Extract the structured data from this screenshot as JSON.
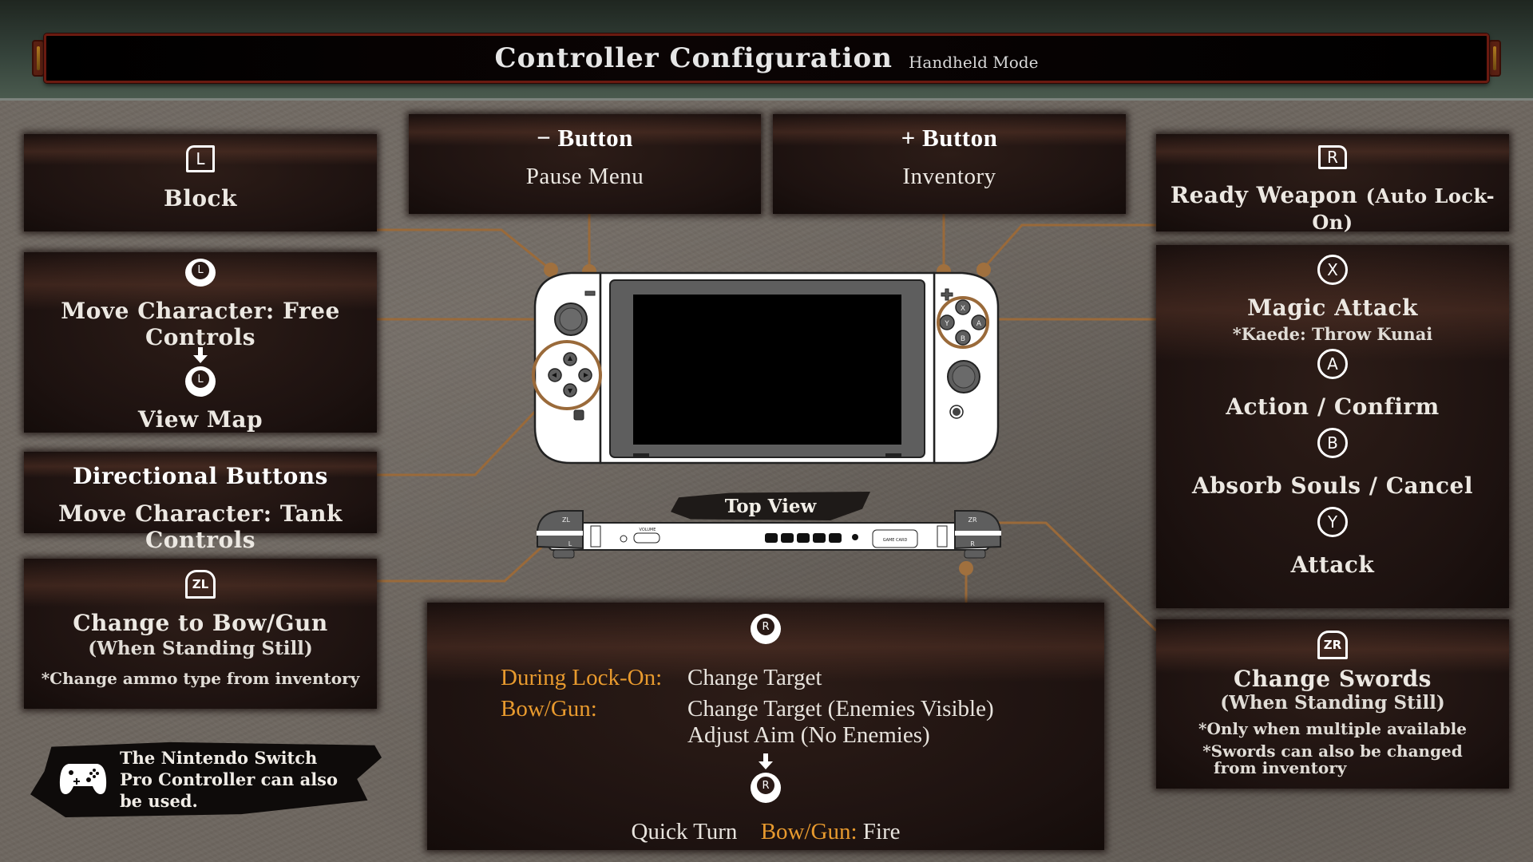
{
  "header": {
    "title": "Controller Configuration",
    "mode": "Handheld Mode"
  },
  "colors": {
    "accent_orange": "#e89a2e",
    "connector": "#9a6a3a",
    "header_green": "#34423a",
    "panel_dark": "#1d1210"
  },
  "panels": {
    "l_button": {
      "icon": "L",
      "label": "Block"
    },
    "l_stick": {
      "icon": "L",
      "label": "Move Character: Free Controls",
      "press_icon": "L",
      "press_label": "View Map"
    },
    "dpad": {
      "title": "Directional Buttons",
      "label": "Move Character: Tank Controls"
    },
    "zl_button": {
      "icon": "ZL",
      "label": "Change to Bow/Gun",
      "condition": "(When Standing Still)",
      "note": "*Change ammo type from inventory"
    },
    "minus_button": {
      "title_symbol": "−",
      "title": "Button",
      "label": "Pause Menu"
    },
    "plus_button": {
      "title_symbol": "+",
      "title": "Button",
      "label": "Inventory"
    },
    "r_button": {
      "icon": "R",
      "label": "Ready Weapon",
      "condition": "(Auto Lock-On)"
    },
    "face_buttons": [
      {
        "icon": "X",
        "label": "Magic Attack",
        "note": "*Kaede: Throw Kunai"
      },
      {
        "icon": "A",
        "label": "Action / Confirm"
      },
      {
        "icon": "B",
        "label": "Absorb Souls / Cancel"
      },
      {
        "icon": "Y",
        "label": "Attack"
      }
    ],
    "zr_button": {
      "icon": "ZR",
      "label": "Change Swords",
      "condition": "(When Standing Still)",
      "notes": [
        "*Only when multiple available",
        "*Swords can also be changed",
        "from inventory"
      ]
    },
    "r_stick": {
      "icon": "R",
      "rows": [
        {
          "key": "During Lock-On:",
          "values": [
            "Change Target"
          ]
        },
        {
          "key": "Bow/Gun:",
          "values": [
            "Change Target (Enemies Visible)",
            "Adjust Aim (No Enemies)"
          ]
        }
      ],
      "press_icon": "R",
      "press_label": "Quick Turn",
      "press_key": "Bow/Gun:",
      "press_value": "Fire"
    }
  },
  "console": {
    "face_buttons": [
      "X",
      "A",
      "B",
      "Y"
    ],
    "top_view_label": "Top View",
    "top_labels": {
      "zl": "ZL",
      "l": "L",
      "zr": "ZR",
      "r": "R",
      "volume": "VOLUME",
      "game_card": "GAME CARD"
    }
  },
  "pro_controller_note": [
    "The Nintendo Switch",
    "Pro Controller can also",
    "be used."
  ]
}
